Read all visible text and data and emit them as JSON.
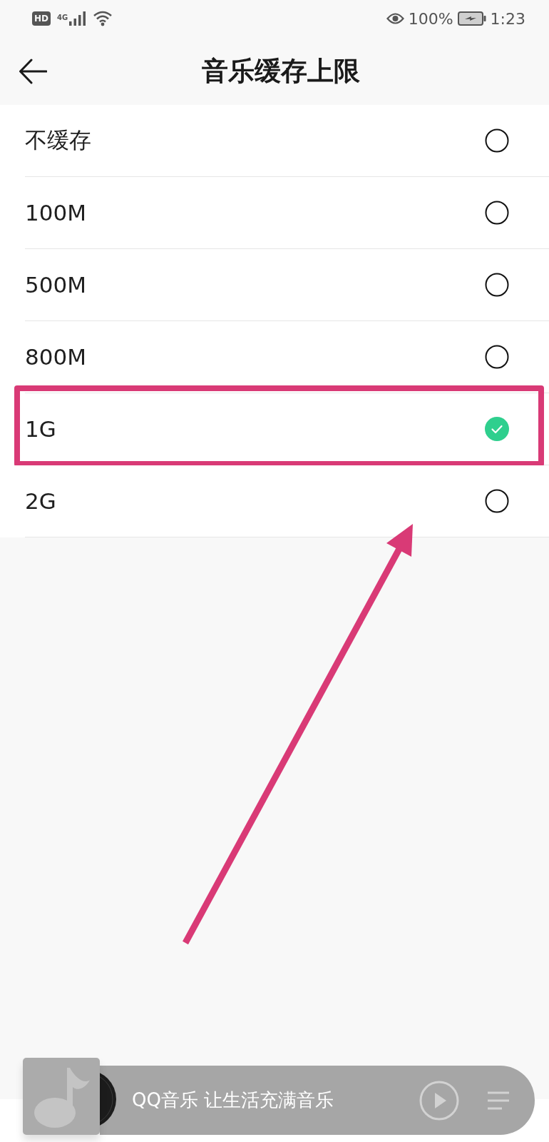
{
  "status_bar": {
    "hd_badge": "HD",
    "network": "4G",
    "battery": "100%",
    "time": "1:23"
  },
  "header": {
    "title": "音乐缓存上限"
  },
  "options": [
    {
      "label": "不缓存",
      "selected": false,
      "highlighted": false
    },
    {
      "label": "100M",
      "selected": false,
      "highlighted": false
    },
    {
      "label": "500M",
      "selected": false,
      "highlighted": false
    },
    {
      "label": "800M",
      "selected": false,
      "highlighted": false
    },
    {
      "label": "1G",
      "selected": true,
      "highlighted": true
    },
    {
      "label": "2G",
      "selected": false,
      "highlighted": false
    }
  ],
  "mini_player": {
    "slogan": "QQ音乐 让生活充满音乐"
  }
}
